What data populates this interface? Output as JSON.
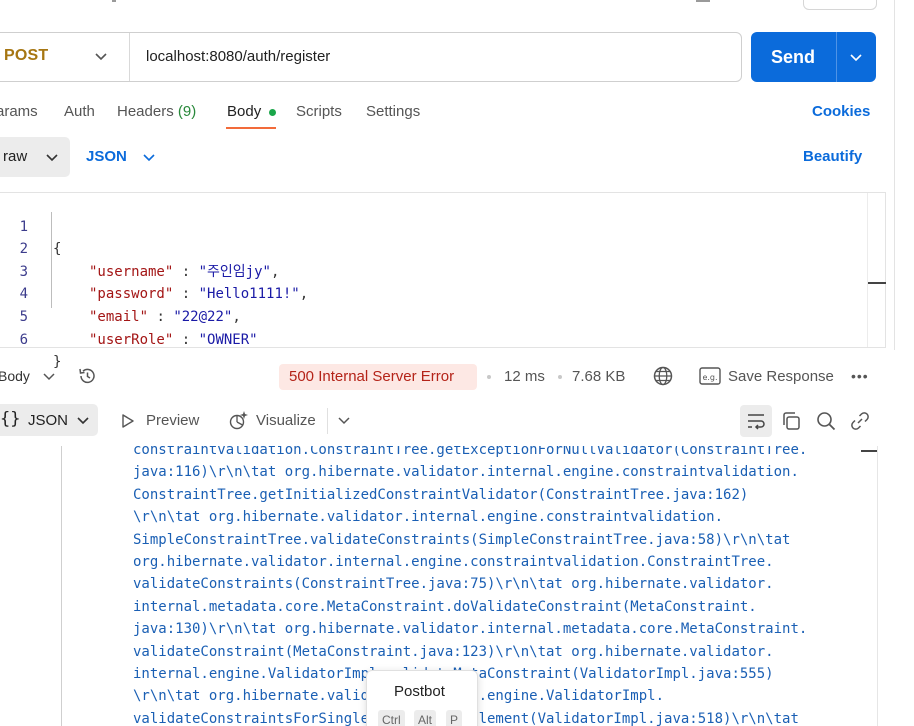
{
  "request": {
    "method": "POST",
    "url": "localhost:8080/auth/register",
    "send_label": "Send"
  },
  "tabs": [
    {
      "label": "arams"
    },
    {
      "label": "Auth"
    },
    {
      "label": "Headers",
      "count": "(9)"
    },
    {
      "label": "Body",
      "active": true
    },
    {
      "label": "Scripts"
    },
    {
      "label": "Settings"
    }
  ],
  "cookies_label": "Cookies",
  "body_mode": {
    "mode": "raw",
    "format": "JSON",
    "beautify_label": "Beautify"
  },
  "editor": {
    "line_numbers": [
      "1",
      "2",
      "3",
      "4",
      "5",
      "6"
    ],
    "lines": [
      {
        "open": "{"
      },
      {
        "key": "\"username\"",
        "sep": " : ",
        "value": "\"주인임jy\"",
        "tail": ","
      },
      {
        "key": "\"password\"",
        "sep": " : ",
        "value": "\"Hello1111!\"",
        "tail": ","
      },
      {
        "key": "\"email\"",
        "sep": " : ",
        "value": "\"22@22\"",
        "tail": ","
      },
      {
        "key": "\"userRole\"",
        "sep": " : ",
        "value": "\"OWNER\"",
        "tail": ""
      },
      {
        "open": "}"
      }
    ]
  },
  "response": {
    "body_label": "Body",
    "status": "500 Internal Server Error",
    "time": "12 ms",
    "size": "7.68 KB",
    "save_label": "Save Response",
    "more": "•••",
    "format": "JSON",
    "format_glyph": "{}",
    "preview_label": "Preview",
    "visualize_label": "Visualize",
    "lines": [
      "constraintvalidation.ConstraintTree.getExceptionForNullValidator(ConstraintTree.",
      "java:116)\\r\\n\\tat org.hibernate.validator.internal.engine.constraintvalidation.",
      "ConstraintTree.getInitializedConstraintValidator(ConstraintTree.java:162)",
      "\\r\\n\\tat org.hibernate.validator.internal.engine.constraintvalidation.",
      "SimpleConstraintTree.validateConstraints(SimpleConstraintTree.java:58)\\r\\n\\tat",
      "org.hibernate.validator.internal.engine.constraintvalidation.ConstraintTree.",
      "validateConstraints(ConstraintTree.java:75)\\r\\n\\tat org.hibernate.validator.",
      "internal.metadata.core.MetaConstraint.doValidateConstraint(MetaConstraint.",
      "java:130)\\r\\n\\tat org.hibernate.validator.internal.metadata.core.MetaConstraint.",
      "validateConstraint(MetaConstraint.java:123)\\r\\n\\tat org.hibernate.validator.",
      "internal.engine.ValidatorImpl.validateMetaConstraint(ValidatorImpl.java:555)",
      "\\r\\n\\tat org.hibernate.validator.internal.engine.ValidatorImpl.",
      "validateConstraintsForSingleDefaultGroupElement(ValidatorImpl.java:518)\\r\\n\\tat"
    ]
  },
  "postbot": {
    "title": "Postbot",
    "keys": [
      "Ctrl",
      "Alt",
      "P"
    ]
  },
  "icons": {
    "method_chevron": "chevron-down-icon",
    "send_chevron": "chevron-down-icon",
    "history": "history-icon",
    "globe": "globe-icon",
    "save": "save-response-icon",
    "preview": "play-icon",
    "visualize": "visualize-icon",
    "wrap": "wrap-lines-icon",
    "copy": "copy-icon",
    "search": "search-icon",
    "link": "link-icon"
  },
  "colors": {
    "method": "#a67612",
    "accent": "#0b6bdb",
    "active_tab_underline": "#f26b3a",
    "body_dot": "#1aa64a",
    "error_badge_bg": "#fde8e4",
    "error_text": "#b42318",
    "response_text": "#1a5fb4",
    "json_key": "#a31515",
    "json_string": "#1a1aa6"
  }
}
